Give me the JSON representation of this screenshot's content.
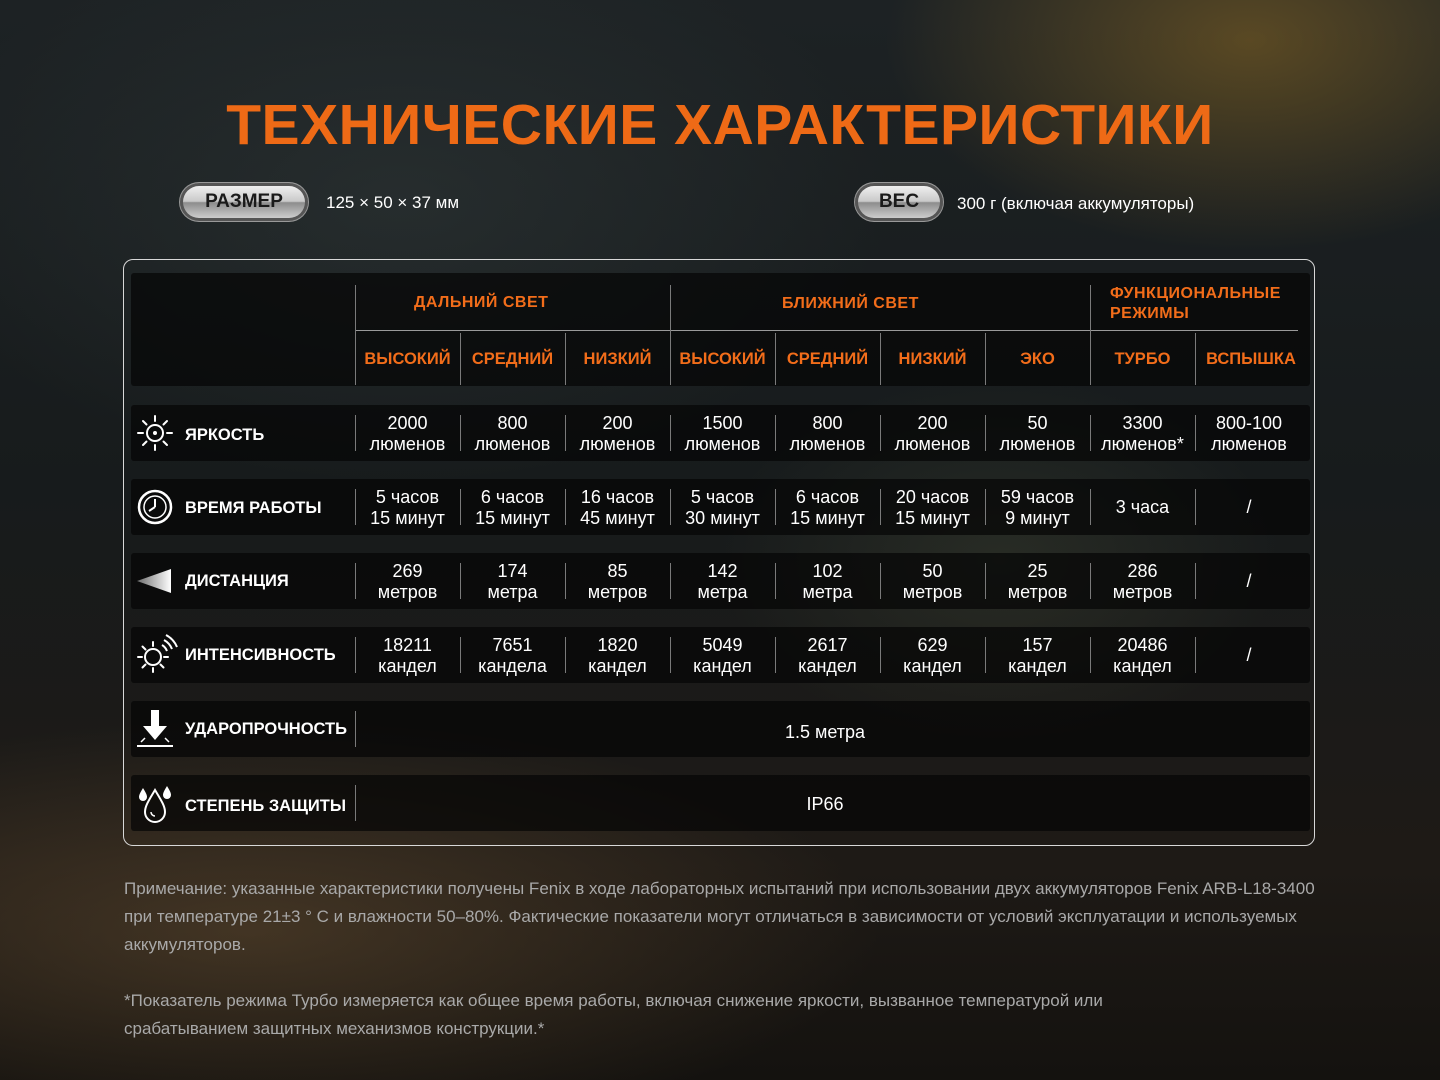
{
  "title": "ТЕХНИЧЕСКИЕ ХАРАКТЕРИСТИКИ",
  "size": {
    "label": "РАЗМЕР",
    "value": "125 × 50 × 37 мм"
  },
  "weight": {
    "label": "ВЕС",
    "value": "300 г (включая аккумуляторы)"
  },
  "groups": {
    "far": "ДАЛЬНИЙ СВЕТ",
    "near": "БЛИЖНИЙ СВЕТ",
    "func_line1": "ФУНКЦИОНАЛЬНЫЕ",
    "func_line2": "РЕЖИМЫ"
  },
  "modes": [
    "ВЫСОКИЙ",
    "СРЕДНИЙ",
    "НИЗКИЙ",
    "ВЫСОКИЙ",
    "СРЕДНИЙ",
    "НИЗКИЙ",
    "ЭКО",
    "ТУРБО",
    "ВСПЫШКА"
  ],
  "rows": {
    "brightness": {
      "label": "ЯРКОСТЬ",
      "icon": "sun-icon",
      "values": [
        "2000\nлюменов",
        "800\nлюменов",
        "200\nлюменов",
        "1500\nлюменов",
        "800\nлюменов",
        "200\nлюменов",
        "50\nлюменов",
        "3300\nлюменов*",
        "800-100\nлюменов"
      ]
    },
    "runtime": {
      "label": "ВРЕМЯ РАБОТЫ",
      "icon": "clock-icon",
      "values": [
        "5 часов\n15 минут",
        "6 часов\n15 минут",
        "16 часов\n45 минут",
        "5 часов\n30 минут",
        "6 часов\n15 минут",
        "20 часов\n15 минут",
        "59 часов\n9 минут",
        "3 часа",
        "/"
      ]
    },
    "distance": {
      "label": "ДИСТАНЦИЯ",
      "icon": "beam-icon",
      "values": [
        "269\nметров",
        "174\nметра",
        "85\nметров",
        "142\nметра",
        "102\nметра",
        "50\nметров",
        "25\nметров",
        "286\nметров",
        "/"
      ]
    },
    "intensity": {
      "label": "ИНТЕНСИВНОСТЬ",
      "icon": "intensity-icon",
      "values": [
        "18211\nкандел",
        "7651\nкандела",
        "1820\nкандел",
        "5049\nкандел",
        "2617\nкандел",
        "629\nкандел",
        "157\nкандел",
        "20486\nкандел",
        "/"
      ]
    },
    "impact": {
      "label": "УДАРОПРОЧНОСТЬ",
      "icon": "impact-icon",
      "value": "1.5 метра"
    },
    "protection": {
      "label": "СТЕПЕНЬ ЗАЩИТЫ",
      "icon": "water-drops-icon",
      "value": "IP66"
    }
  },
  "notes": {
    "note1": "Примечание: указанные характеристики получены Fenix в ходе лабораторных испытаний при использовании двух аккумуляторов Fenix ARB-L18-3400 при температуре 21±3 ° C и влажности 50–80%. Фактические показатели могут отличаться в зависимости от условий эксплуатации и используемых аккумуляторов.",
    "note2": "*Показатель режима Турбо измеряется как общее время работы, включая снижение яркости, вызванное температурой или срабатыванием защитных механизмов конструкции.*"
  }
}
